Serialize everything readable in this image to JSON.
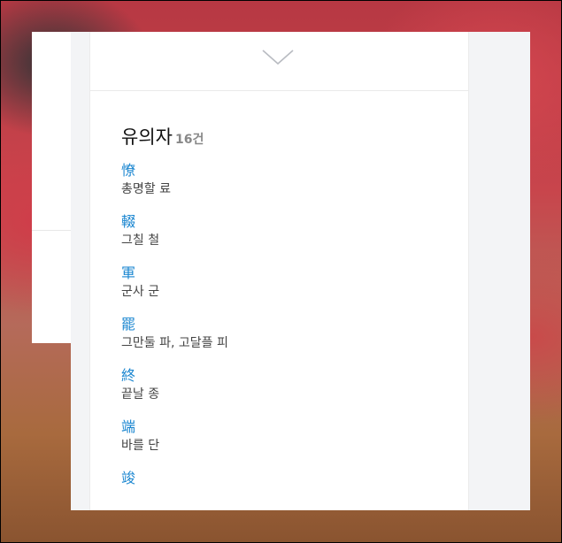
{
  "synonyms": {
    "title": "유의자",
    "count": "16건",
    "items": [
      {
        "hanja": "憭",
        "meaning": "총명할 료"
      },
      {
        "hanja": "輟",
        "meaning": "그칠 철"
      },
      {
        "hanja": "軍",
        "meaning": "군사 군"
      },
      {
        "hanja": "罷",
        "meaning": "그만둘 파, 고달플 피"
      },
      {
        "hanja": "終",
        "meaning": "끝날 종"
      },
      {
        "hanja": "端",
        "meaning": "바를 단"
      },
      {
        "hanja": "竣",
        "meaning": ""
      }
    ]
  },
  "icons": {
    "expand": "chevron-down-icon"
  },
  "colors": {
    "link": "#1a86d0",
    "text": "#444444",
    "panel_bg": "#f3f4f6"
  }
}
